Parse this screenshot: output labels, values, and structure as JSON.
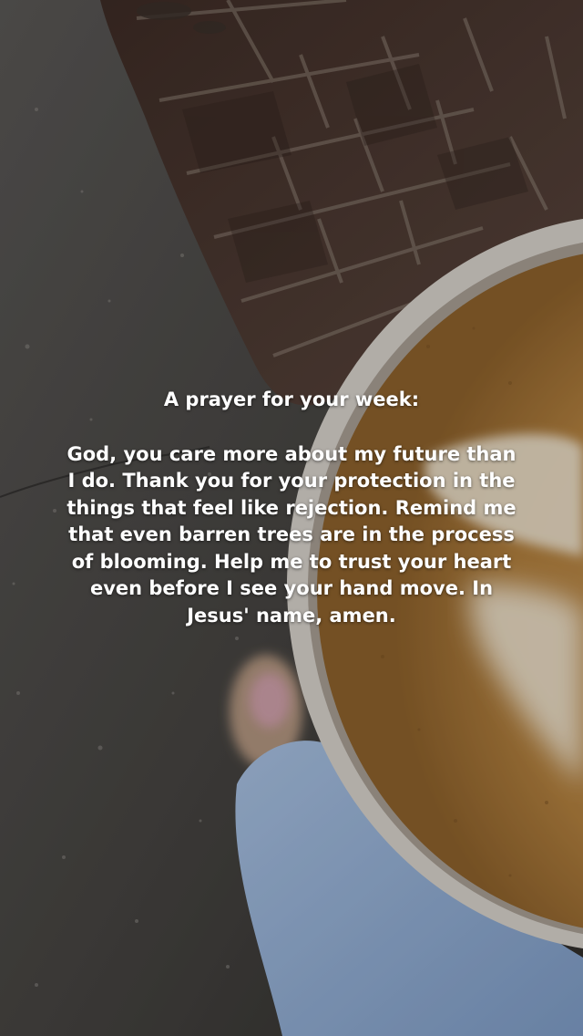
{
  "story": {
    "heading": "A prayer for your week:",
    "body": "God, you care more about my future than I do. Thank you for your protection in the things that feel like rejection. Remind me that even barren trees are in the process of blooming. Help me to trust your heart even before I see your hand move. In Jesus' name, amen."
  },
  "photo": {
    "subject": "latte-art-coffee-cup-over-sidewalk",
    "colors": {
      "pavement": "#4a4846",
      "brick": "#4c3a33",
      "cup_rim": "#d9d5cf",
      "coffee": "#b98a4e",
      "foam": "#eee3cf",
      "jeans": "#93b1d6"
    }
  }
}
